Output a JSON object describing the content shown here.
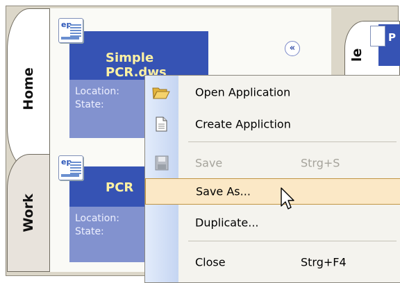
{
  "tabs": {
    "home": "Home",
    "work": "Work"
  },
  "right_panel": {
    "tab_partial": "le",
    "header_partial": "P"
  },
  "cards": [
    {
      "title": "Simple PCR.dws",
      "location_label": "Location:",
      "state_label": "State:",
      "icon": "ep-document-icon",
      "icon_text": "ep",
      "collapse_icon": "«"
    },
    {
      "title": "PCR",
      "location_label": "Location:",
      "state_label": "State:",
      "icon": "ep-document-icon",
      "icon_text": "ep"
    }
  ],
  "context_menu": {
    "items": [
      {
        "label": "Open Application",
        "icon": "folder-open-icon",
        "enabled": true
      },
      {
        "label": "Create Appliction",
        "icon": "new-document-icon",
        "enabled": true
      },
      {
        "label": "Save",
        "shortcut": "Strg+S",
        "icon": "floppy-disk-icon",
        "enabled": false
      },
      {
        "label": "Save As...",
        "enabled": true,
        "highlighted": true
      },
      {
        "label": "Duplicate...",
        "enabled": true
      },
      {
        "label": "Close",
        "shortcut": "Strg+F4",
        "enabled": true
      }
    ]
  },
  "colors": {
    "card_header": "#3653b4",
    "card_title": "#fff2a3",
    "card_body": "#8292cf",
    "menu_highlight": "#fbe8c6",
    "tab_background": "#dcd7c9"
  }
}
